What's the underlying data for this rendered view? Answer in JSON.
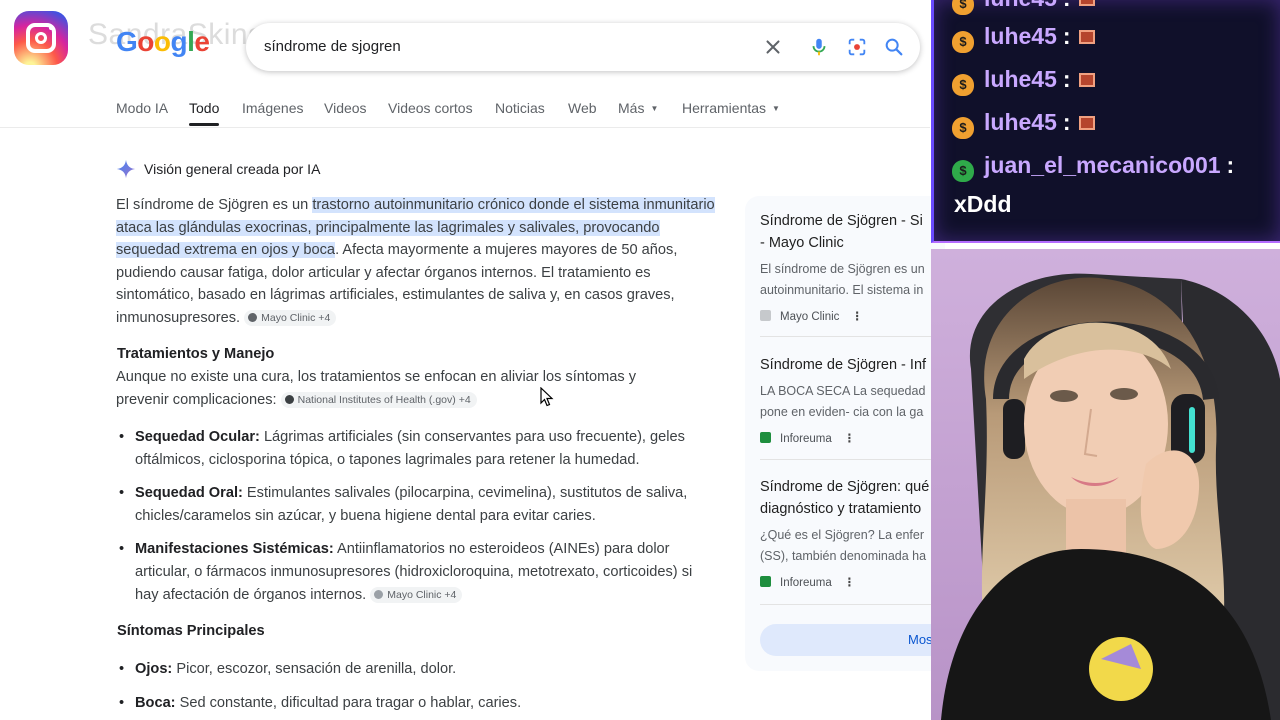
{
  "overlay": {
    "instagram_handle": "SandraSkins"
  },
  "header": {
    "logo_text": "Google",
    "logo_colors": [
      "#4285F4",
      "#EA4335",
      "#FBBC05",
      "#4285F4",
      "#34A853",
      "#EA4335"
    ],
    "search_query": "síndrome de sjogren",
    "icons": [
      "clear-icon",
      "microphone-icon",
      "lens-icon",
      "search-icon"
    ]
  },
  "tabs": [
    {
      "label": "Modo IA"
    },
    {
      "label": "Todo",
      "active": true
    },
    {
      "label": "Imágenes"
    },
    {
      "label": "Videos"
    },
    {
      "label": "Videos cortos"
    },
    {
      "label": "Noticias"
    },
    {
      "label": "Web"
    },
    {
      "label": "Más"
    },
    {
      "label": "Herramientas"
    }
  ],
  "ai_overview": {
    "heading": "Visión general creada por IA",
    "intro": {
      "plain_1": "El síndrome de Sjögren es un ",
      "highlighted": "trastorno autoinmunitario crónico donde el sistema inmunitario ataca las glándulas exocrinas, principalmente las lagrimales y salivales, provocando sequedad extrema en ojos y boca",
      "plain_2": ". Afecta mayormente a mujeres mayores de 50 años, pudiendo causar fatiga, dolor articular y afectar órganos internos. El tratamiento es sintomático, basado en lágrimas artificiales, estimulantes de saliva y, en casos graves, inmunosupresores.",
      "source": "Mayo Clinic +4"
    },
    "treatment": {
      "title": "Tratamientos y Manejo",
      "text": "Aunque no existe una cura, los tratamientos se enfocan en aliviar los síntomas y prevenir complicaciones:",
      "source": "National Institutes of Health (.gov) +4",
      "items": [
        {
          "label": "Sequedad Ocular:",
          "text": " Lágrimas artificiales (sin conservantes para uso frecuente), geles oftálmicos, ciclosporina tópica, o tapones lagrimales para retener la humedad."
        },
        {
          "label": "Sequedad Oral:",
          "text": " Estimulantes salivales (pilocarpina, cevimelina), sustitutos de saliva, chicles/caramelos sin azúcar, y buena higiene dental para evitar caries."
        },
        {
          "label": "Manifestaciones Sistémicas:",
          "text": " Antiinflamatorios no esteroideos (AINEs) para dolor articular, o fármacos inmunosupresores (hidroxicloroquina, metotrexato, corticoides) si hay afectación de órganos internos.",
          "source": "Mayo Clinic +4"
        }
      ]
    },
    "symptoms": {
      "title": "Síntomas Principales",
      "items": [
        {
          "label": "Ojos:",
          "text": " Picor, escozor, sensación de arenilla, dolor."
        },
        {
          "label": "Boca:",
          "text": " Sed constante, dificultad para tragar o hablar, caries."
        }
      ]
    }
  },
  "side_panel": {
    "cards": [
      {
        "title_1": "Síndrome de Sjögren - Si",
        "title_2": "- Mayo Clinic",
        "snippet_1": "El síndrome de Sjögren es un",
        "snippet_2": "autoinmunitario. El sistema in",
        "source": "Mayo Clinic",
        "source_color": "#9aa0a6"
      },
      {
        "title_1": "Síndrome de Sjögren - Inf",
        "snippet_1": "LA BOCA SECA La sequedad",
        "snippet_2": "pone en eviden- cia con la ga",
        "source": "Inforeuma",
        "source_color": "#1e8e3e"
      },
      {
        "title_1": "Síndrome de Sjögren: qué",
        "title_2": "diagnóstico y tratamiento",
        "snippet_1": "¿Qué es el Sjögren? La enfer",
        "snippet_2": "(SS), también denominada ha",
        "source": "Inforeuma",
        "source_color": "#1e8e3e"
      }
    ],
    "more_button": "Mos"
  },
  "chat": {
    "messages": [
      {
        "user": "luhe45",
        "badge_color": "#f0a030"
      },
      {
        "user": "luhe45",
        "badge_color": "#f0a030"
      },
      {
        "user": "luhe45",
        "badge_color": "#f0a030"
      },
      {
        "user": "luhe45",
        "badge_color": "#f0a030"
      },
      {
        "user": "juan_el_mecanico001",
        "badge_color": "#2faa4a"
      }
    ],
    "last_message": "xDdd",
    "badge_glyph": "$",
    "separator": ":"
  }
}
